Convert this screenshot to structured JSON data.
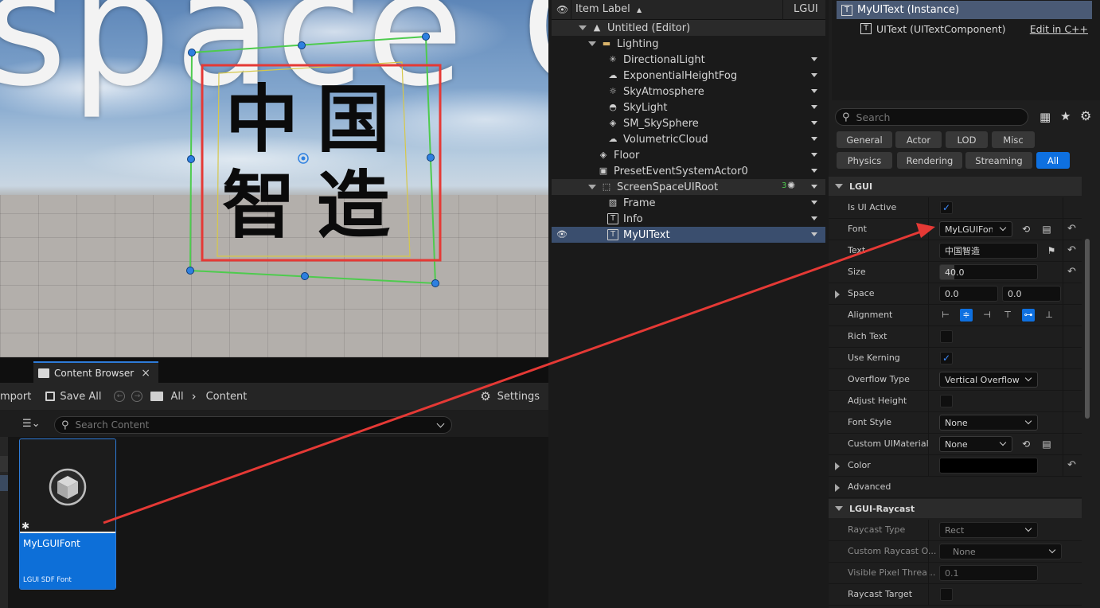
{
  "viewport": {
    "background_text": "space C",
    "ui_text_chars": [
      "中",
      "国",
      "智",
      "造"
    ]
  },
  "content_browser": {
    "tab_label": "Content Browser",
    "tab_close": "×",
    "toolbar": {
      "import_label": "mport",
      "save_all_label": "Save All",
      "all_label": "All",
      "separator": "›",
      "content_label": "Content",
      "settings_label": "Settings"
    },
    "search_placeholder": "Search Content",
    "asset": {
      "name": "MyLGUIFont",
      "type": "LGUI SDF Font",
      "badge": "✱"
    }
  },
  "outliner": {
    "header_label": "Item Label",
    "header_sort": "▲",
    "header_col2": "LGUI",
    "rows": [
      {
        "label": "Untitled (Editor)",
        "icon": "level-icon"
      },
      {
        "label": "Lighting",
        "icon": "folder-icon"
      },
      {
        "label": "DirectionalLight",
        "icon": "directional-light-icon"
      },
      {
        "label": "ExponentialHeightFog",
        "icon": "fog-icon"
      },
      {
        "label": "SkyAtmosphere",
        "icon": "sky-atmosphere-icon"
      },
      {
        "label": "SkyLight",
        "icon": "skylight-icon"
      },
      {
        "label": "SM_SkySphere",
        "icon": "static-mesh-icon"
      },
      {
        "label": "VolumetricCloud",
        "icon": "cloud-icon"
      },
      {
        "label": "Floor",
        "icon": "static-mesh-icon"
      },
      {
        "label": "PresetEventSystemActor0",
        "icon": "actor-icon"
      },
      {
        "label": "ScreenSpaceUIRoot",
        "icon": "ui-root-icon",
        "badge": "3"
      },
      {
        "label": "Frame",
        "icon": "image-icon"
      },
      {
        "label": "Info",
        "icon": "text-icon"
      },
      {
        "label": "MyUIText",
        "icon": "text-icon"
      }
    ]
  },
  "details": {
    "component_selected": "MyUIText (Instance)",
    "component_child": "UIText (UITextComponent)",
    "edit_link": "Edit in C++",
    "search_placeholder": "Search",
    "categories": [
      "General",
      "Actor",
      "LOD",
      "Misc",
      "Physics",
      "Rendering",
      "Streaming",
      "All"
    ],
    "active_category": "All",
    "sections": {
      "lgui": "LGUI",
      "raycast": "LGUI-Raycast"
    },
    "props": {
      "is_ui_active": "Is UI Active",
      "font": "Font",
      "font_value": "MyLGUIFont",
      "text": "Text",
      "text_value": "中国智造",
      "size": "Size",
      "size_value": "40.0",
      "space": "Space",
      "space_x": "0.0",
      "space_y": "0.0",
      "alignment": "Alignment",
      "rich_text": "Rich Text",
      "use_kerning": "Use Kerning",
      "overflow_type": "Overflow Type",
      "overflow_value": "Vertical Overflow",
      "adjust_height": "Adjust Height",
      "font_style": "Font Style",
      "font_style_value": "None",
      "custom_material": "Custom UIMaterial",
      "custom_material_value": "None",
      "color": "Color",
      "advanced": "Advanced",
      "raycast_type": "Raycast Type",
      "raycast_type_value": "Rect",
      "custom_raycast": "Custom Raycast O...",
      "custom_raycast_value": "None",
      "visible_pixel": "Visible Pixel Threa...",
      "visible_pixel_value": "0.1",
      "raycast_target": "Raycast Target"
    },
    "check_mark": "✓",
    "reset_glyph": "↶"
  },
  "colors": {
    "accent": "#0e70e0",
    "annotation_arrow": "#e53935",
    "selection_box": "#e53935",
    "gizmo_outline": "#4ecb4e"
  }
}
